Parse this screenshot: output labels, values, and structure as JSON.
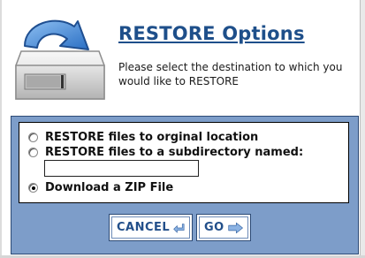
{
  "dialog": {
    "title": "RESTORE Options",
    "subtitle": "Please select the destination to which you would like to RESTORE",
    "header_icon": "drive-restore-icon"
  },
  "options": {
    "original": {
      "label": "RESTORE files to orginal location",
      "checked": false
    },
    "subdirectory": {
      "label": "RESTORE files to a subdirectory named:",
      "checked": false
    },
    "zip": {
      "label": "Download a ZIP File",
      "checked": true
    }
  },
  "subdir_input": {
    "value": "",
    "placeholder": ""
  },
  "buttons": {
    "cancel": {
      "label": "CANCEL",
      "icon": "back-arrow-icon"
    },
    "go": {
      "label": "GO",
      "icon": "forward-arrow-icon"
    }
  },
  "colors": {
    "title": "#1e4f8a",
    "panel": "#7d9dc9",
    "button_text": "#224f8a"
  }
}
